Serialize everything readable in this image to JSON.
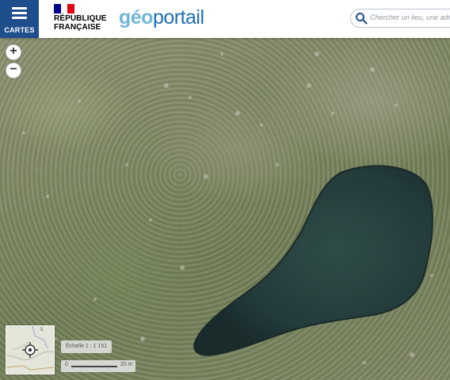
{
  "header": {
    "menu_label": "CARTES",
    "republic_line1": "RÉPUBLIQUE",
    "republic_line2": "FRANÇAISE",
    "logo_part1": "géo",
    "logo_part2": "portail"
  },
  "search": {
    "placeholder": "Chercher un lieu, une adresse"
  },
  "zoom": {
    "in_symbol": "+",
    "out_symbol": "−"
  },
  "scale": {
    "text": "Échelle 1 : 1 151",
    "start": "0",
    "end": "20 m"
  },
  "icons": {
    "menu": "hamburger-icon",
    "search": "search-icon",
    "flag": "marianne-flag-icon",
    "locate": "crosshair-icon"
  },
  "colors": {
    "menu_bg": "#1f4e8c",
    "logo_light": "#6fb6d9",
    "logo_dark": "#1d6fb8"
  }
}
